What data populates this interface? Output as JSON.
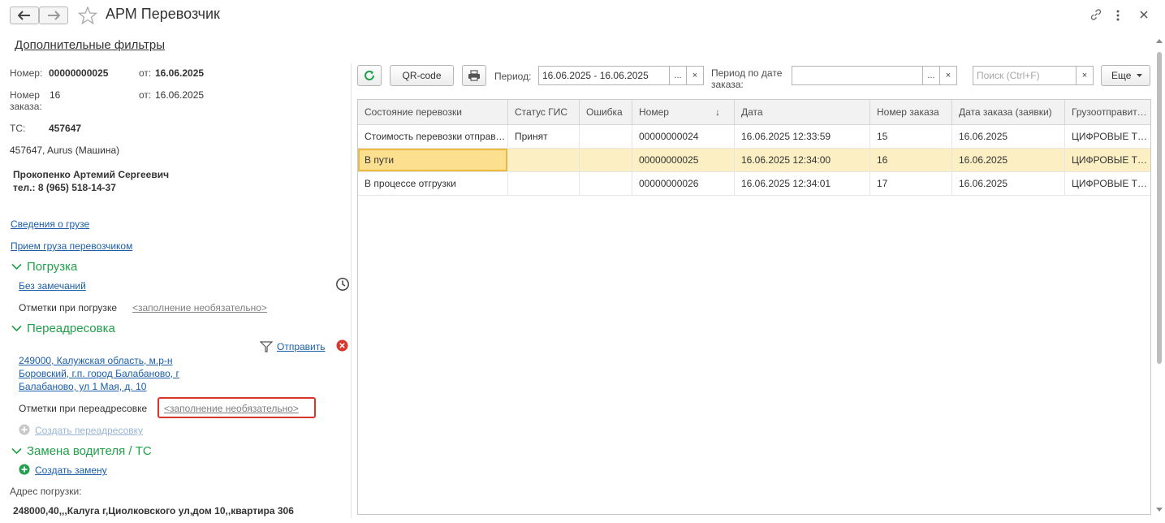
{
  "window": {
    "title": "АРМ Перевозчик",
    "back_icon": "arrow-left-icon",
    "forward_icon": "arrow-right-icon",
    "favorite_icon": "star-icon",
    "link_icon": "link-icon",
    "more_icon": "vertical-dots-icon",
    "close_icon": "close-icon"
  },
  "filters_link": "Дополнительные фильтры",
  "details": {
    "number_label": "Номер:",
    "number_value": "00000000025",
    "from_label_1": "от:",
    "date_value": "16.06.2025",
    "order_label": "Номер заказа:",
    "order_value": "16",
    "from_label_2": "от:",
    "order_date_value": "16.06.2025",
    "vehicle_label": "ТС:",
    "vehicle_value": "457647",
    "vehicle_desc": "457647, Aurus (Машина)",
    "driver_name": "Прокопенко Артемий Сергеевич",
    "driver_phone": "тел.: 8 (965) 518-14-37"
  },
  "links": {
    "cargo_info": "Сведения о грузе",
    "cargo_accept": "Прием груза перевозчиком"
  },
  "loading": {
    "title": "Погрузка",
    "status_link": "Без замечаний",
    "notes_label": "Отметки при погрузке",
    "notes_placeholder": "<заполнение необязательно>"
  },
  "redirect": {
    "title": "Переадресовка",
    "send_label": "Отправить",
    "address_line1": "249000, Калужская область, м.р-н",
    "address_line2": "Боровский, г.п. город Балабаново, г",
    "address_line3": "Балабаново, ул 1 Мая, д. 10",
    "notes_label": "Отметки при переадресовке",
    "notes_placeholder": "<заполнение необязательно>",
    "create_label": "Создать переадресовку"
  },
  "driver_change": {
    "title": "Замена водителя / ТС",
    "create_label": "Создать замену"
  },
  "loading_address": {
    "label": "Адрес погрузки:",
    "value": "248000,40,,,Калуга г,Циолковского ул,дом 10,,квартира 306"
  },
  "toolbar": {
    "refresh_icon": "refresh-icon",
    "qr_label": "QR-code",
    "print_icon": "printer-icon",
    "period_label": "Период:",
    "period_value": "16.06.2025 - 16.06.2025",
    "select_btn": "...",
    "clear_btn": "×",
    "order_period_label1": "Период по дате",
    "order_period_label2": "заказа:",
    "order_period_value": "",
    "search_placeholder": "Поиск (Ctrl+F)",
    "more_label": "Еще"
  },
  "table": {
    "columns": [
      "Состояние перевозки",
      "Статус ГИС",
      "Ошибка",
      "Номер",
      "Дата",
      "Номер заказа",
      "Дата заказа (заявки)",
      "Грузоотправитель"
    ],
    "sort_indicator": "↓",
    "rows": [
      [
        "Стоимость перевозки отправлена",
        "Принят",
        "",
        "00000000024",
        "16.06.2025 12:33:59",
        "15",
        "16.06.2025",
        "ЦИФРОВЫЕ ТЕХНОЛОГИИ"
      ],
      [
        "В пути",
        "",
        "",
        "00000000025",
        "16.06.2025 12:34:00",
        "16",
        "16.06.2025",
        "ЦИФРОВЫЕ ТЕХНОЛОГИИ"
      ],
      [
        "В процессе отгрузки",
        "",
        "",
        "00000000026",
        "16.06.2025 12:34:01",
        "17",
        "16.06.2025",
        "ЦИФРОВЫЕ ТЕХНОЛОГИИ"
      ]
    ],
    "selected_row": 1
  },
  "colors": {
    "accent_green": "#20a04a",
    "link_blue": "#1b5ea8",
    "selected_row": "#fbefc3",
    "highlight_box": "#d9362b"
  }
}
